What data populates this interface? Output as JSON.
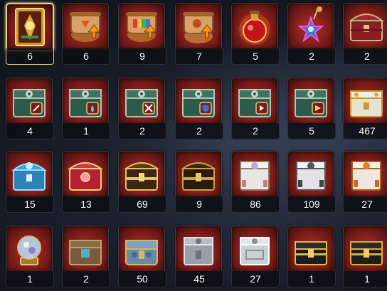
{
  "inventory": {
    "rows": [
      [
        {
          "name": "golden-card-icon",
          "count": "6",
          "selected": true
        },
        {
          "name": "scroll-fire-icon",
          "count": "6"
        },
        {
          "name": "scroll-rainbow-icon",
          "count": "9"
        },
        {
          "name": "scroll-bag-icon",
          "count": "7"
        },
        {
          "name": "red-potion-icon",
          "count": "5"
        },
        {
          "name": "star-pendant-icon",
          "count": "2"
        },
        {
          "name": "red-chest-icon",
          "count": "2"
        }
      ],
      [
        {
          "name": "green-chest-sword-icon",
          "count": "4"
        },
        {
          "name": "green-chest-water-icon",
          "count": "1"
        },
        {
          "name": "green-chest-swords-icon",
          "count": "2"
        },
        {
          "name": "green-chest-shield-icon",
          "count": "2"
        },
        {
          "name": "green-chest-arrow-icon",
          "count": "2"
        },
        {
          "name": "green-chest-arrow-alt-icon",
          "count": "5"
        },
        {
          "name": "white-gold-chest-icon",
          "count": "467"
        }
      ],
      [
        {
          "name": "blue-chest-icon",
          "count": "15"
        },
        {
          "name": "ruby-chest-icon",
          "count": "13"
        },
        {
          "name": "gold-chest-icon",
          "count": "69"
        },
        {
          "name": "dark-gold-chest-icon",
          "count": "9"
        },
        {
          "name": "white-pink-crate-icon",
          "count": "86"
        },
        {
          "name": "white-dark-crate-icon",
          "count": "109"
        },
        {
          "name": "white-orange-crate-icon",
          "count": "27"
        }
      ],
      [
        {
          "name": "crystal-globe-icon",
          "count": "1"
        },
        {
          "name": "wooden-chest-icon",
          "count": "2"
        },
        {
          "name": "ornate-blue-chest-icon",
          "count": "50"
        },
        {
          "name": "silver-box-icon",
          "count": "45"
        },
        {
          "name": "silver-ornate-box-icon",
          "count": "27"
        },
        {
          "name": "black-gold-chest-icon",
          "count": "1"
        },
        {
          "name": "black-gold-chest-alt-icon",
          "count": "1"
        }
      ]
    ]
  },
  "colors": {
    "selected_border": "#e7d38d",
    "slot_bg": "#7b1c18",
    "count_text": "#ffffff"
  }
}
